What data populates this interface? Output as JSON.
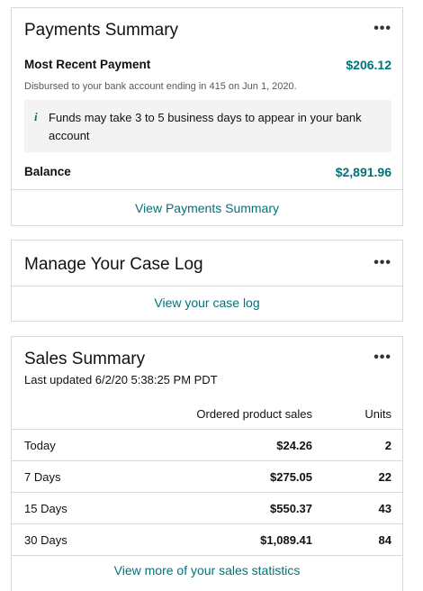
{
  "payments": {
    "title": "Payments Summary",
    "more_label": "•••",
    "recent_label": "Most Recent Payment",
    "recent_value": "$206.12",
    "disbursed_note": "Disbursed to your bank account ending in 415 on Jun 1, 2020.",
    "info_icon": "i",
    "info_text": "Funds may take 3 to 5 business days to appear in your bank account",
    "balance_label": "Balance",
    "balance_value": "$2,891.96",
    "view_link": "View Payments Summary"
  },
  "case_log": {
    "title": "Manage Your Case Log",
    "more_label": "•••",
    "view_link": "View your case log"
  },
  "sales": {
    "title": "Sales Summary",
    "more_label": "•••",
    "last_updated": "Last updated 6/2/20 5:38:25 PM PDT",
    "columns": {
      "sales": "Ordered product sales",
      "units": "Units"
    },
    "rows": [
      {
        "period": "Today",
        "amount": "$24.26",
        "units": "2"
      },
      {
        "period": "7 Days",
        "amount": "$275.05",
        "units": "22"
      },
      {
        "period": "15 Days",
        "amount": "$550.37",
        "units": "43"
      },
      {
        "period": "30 Days",
        "amount": "$1,089.41",
        "units": "84"
      }
    ],
    "view_link": "View more of your sales statistics"
  },
  "colors": {
    "accent": "#00737a",
    "border": "#d5d9d9",
    "info_bg": "#f3f3f3"
  }
}
